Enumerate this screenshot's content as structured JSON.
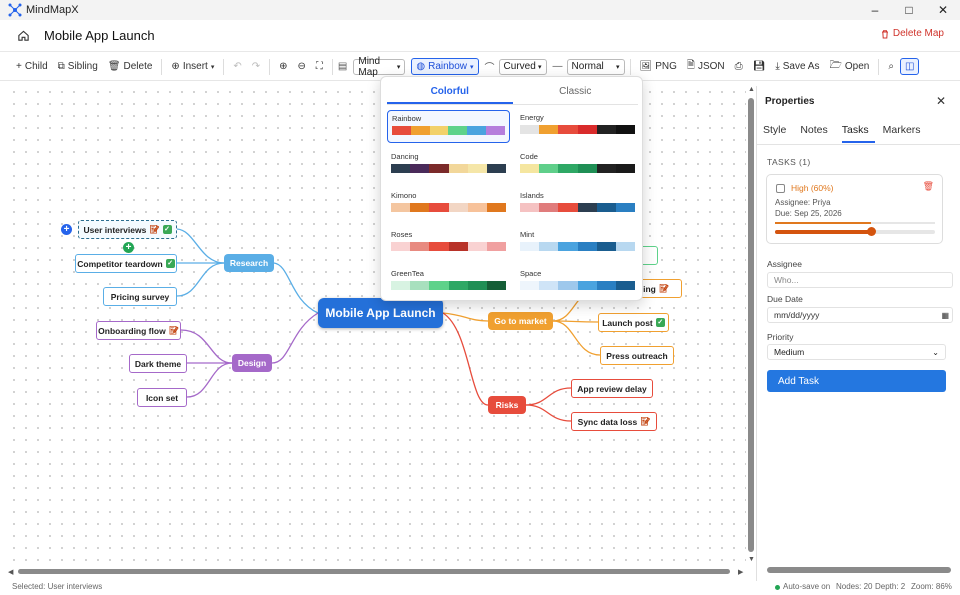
{
  "app": {
    "name": "MindMapX",
    "window_controls": [
      "–",
      "□",
      "✕"
    ]
  },
  "header": {
    "home_icon": "home-icon",
    "map_title": "Mobile App Launch",
    "delete_map_label": "Delete Map"
  },
  "toolbar": {
    "child": "Child",
    "sibling": "Sibling",
    "delete": "Delete",
    "insert": "Insert",
    "layout_value": "Mind Map",
    "theme_label": "Rainbow",
    "edge_value": "Curved",
    "weight_value": "Normal",
    "png": "PNG",
    "json": "JSON",
    "save_as": "Save As",
    "open": "Open"
  },
  "theme_popup": {
    "tabs": [
      "Colorful",
      "Classic"
    ],
    "active_tab": "Colorful",
    "selected": "Rainbow",
    "themes": [
      {
        "name": "Rainbow",
        "colors": [
          "#e74c3c",
          "#f0a030",
          "#f2d16b",
          "#5ed28a",
          "#4aa3df",
          "#b57edc"
        ]
      },
      {
        "name": "Energy",
        "colors": [
          "#e4e4e4",
          "#f0a030",
          "#e74c3c",
          "#d92b2b",
          "#222222",
          "#111111"
        ]
      },
      {
        "name": "Dancing",
        "colors": [
          "#2c3e50",
          "#4a2a5a",
          "#7b2a2a",
          "#f2d79a",
          "#f5e6a8",
          "#2c3e50"
        ]
      },
      {
        "name": "Code",
        "colors": [
          "#f5e6a0",
          "#5fcf8a",
          "#2ea865",
          "#1f8f55",
          "#222222",
          "#1a1a1a"
        ]
      },
      {
        "name": "Kimono",
        "colors": [
          "#f4c6a0",
          "#e0781e",
          "#e74c3c",
          "#f2d6c4",
          "#f7c29a",
          "#e0781e"
        ]
      },
      {
        "name": "Islands",
        "colors": [
          "#f5c2c2",
          "#e07c7c",
          "#e74c3c",
          "#2c3e50",
          "#1a5d8f",
          "#2a7fc2"
        ]
      },
      {
        "name": "Roses",
        "colors": [
          "#f9d2d2",
          "#e88a80",
          "#e74c3c",
          "#b83228",
          "#f9d2d2",
          "#f0a0a0"
        ]
      },
      {
        "name": "Mint",
        "colors": [
          "#e8f2fb",
          "#b8d8f0",
          "#4aa3df",
          "#2a7fc2",
          "#1a5d8f",
          "#b8d8f0"
        ]
      },
      {
        "name": "GreenTea",
        "colors": [
          "#d8f3e2",
          "#a8e0be",
          "#5ed28a",
          "#2ea865",
          "#1f8f55",
          "#155e37"
        ]
      },
      {
        "name": "Space",
        "colors": [
          "#eef5fc",
          "#cfe4f7",
          "#9ec8ec",
          "#4aa3df",
          "#2a7fc2",
          "#1a5d8f"
        ]
      }
    ]
  },
  "mindmap": {
    "root": "Mobile App Launch",
    "branches": [
      {
        "label": "Research",
        "color": "#5aaee6"
      },
      {
        "label": "Design",
        "color": "#a569c9"
      },
      {
        "label": "Go to market",
        "color": "#f0a030"
      },
      {
        "label": "Risks",
        "color": "#e74c3c"
      }
    ],
    "leaves": [
      {
        "label": "User interviews",
        "icons": [
          "📝",
          "✓"
        ]
      },
      {
        "label": "Competitor teardown",
        "icons": [
          "✓"
        ]
      },
      {
        "label": "Pricing survey",
        "icons": []
      },
      {
        "label": "Onboarding flow",
        "icons": [
          "📝"
        ]
      },
      {
        "label": "Dark theme",
        "icons": []
      },
      {
        "label": "Icon set",
        "icons": []
      },
      {
        "label": "ting",
        "icons": [
          "📝"
        ]
      },
      {
        "label": "Launch post",
        "icons": [
          "✓"
        ]
      },
      {
        "label": "Press outreach",
        "icons": []
      },
      {
        "label": "App review delay",
        "icons": []
      },
      {
        "label": "Sync data loss",
        "icons": [
          "📝"
        ]
      }
    ]
  },
  "properties": {
    "title": "Properties",
    "tabs": [
      "Style",
      "Notes",
      "Tasks",
      "Markers"
    ],
    "active_tab": "Tasks",
    "tasks_header": "TASKS (1)",
    "task": {
      "priority_text": "High (60%)",
      "assignee": "Assignee: Priya",
      "due": "Due: Sep 25, 2026",
      "progress": 0.6
    },
    "form": {
      "assignee_label": "Assignee",
      "assignee_placeholder": "Who...",
      "due_label": "Due Date",
      "due_placeholder": "mm/dd/yyyy",
      "priority_label": "Priority",
      "priority_value": "Medium",
      "add_task": "Add Task"
    }
  },
  "status": {
    "selected": "Selected: User interviews",
    "autosave": "Auto-save on",
    "nodes": "Nodes: 20",
    "depth": "Depth: 2",
    "zoom": "Zoom: 86%"
  }
}
